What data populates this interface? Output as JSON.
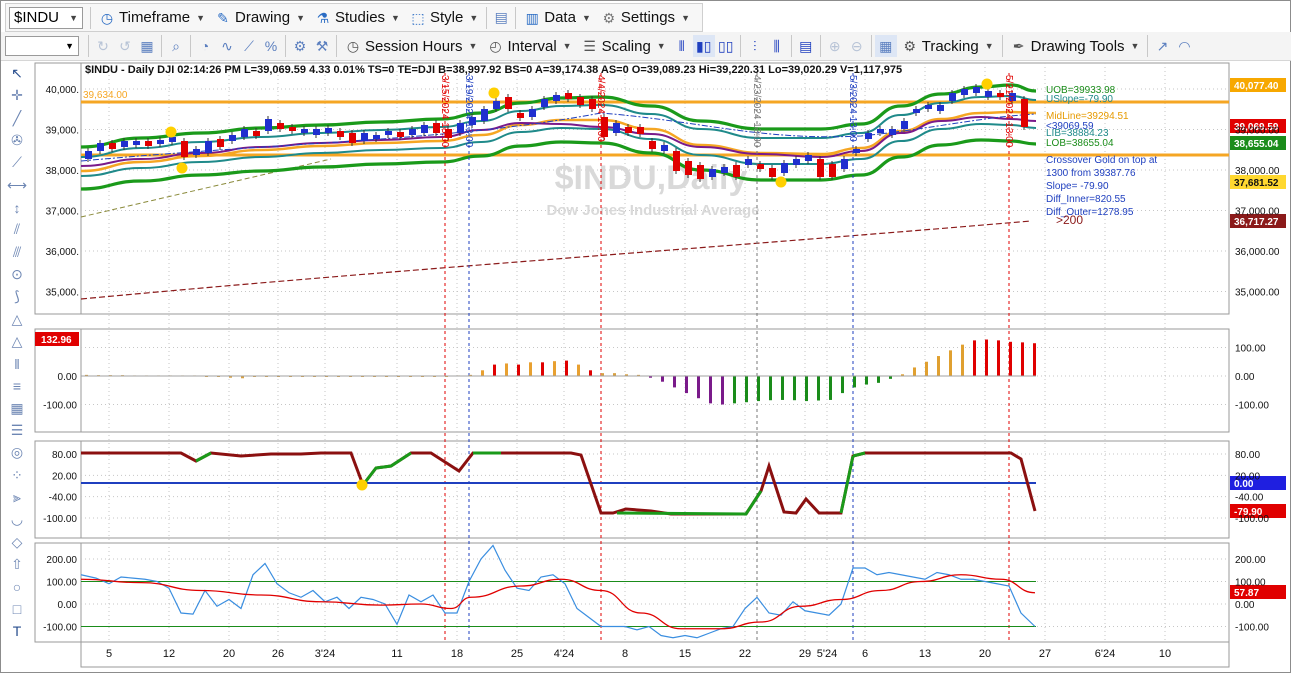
{
  "toolbar1": {
    "symbol": "$INDU",
    "timeframe": "Timeframe",
    "drawing": "Drawing",
    "studies": "Studies",
    "style": "Style",
    "data": "Data",
    "settings": "Settings"
  },
  "toolbar2": {
    "session_hours": "Session Hours",
    "interval": "Interval",
    "scaling": "Scaling",
    "tracking": "Tracking",
    "drawing_tools": "Drawing Tools"
  },
  "header": {
    "line": "$INDU - Daily  DJI  02:14:26 PM  L=39,069.59  4.33  0.01%  TS=0  TE=DJI  B=38,997.92  BS=0  A=39,174.38  AS=0  O=39,089.23  Hi=39,220.31  Lo=39,020.29  V=1,117,975"
  },
  "watermark": {
    "symbol": "$INDU,Daily",
    "name": "Dow Jones Industrial Average"
  },
  "price_panel": {
    "left_level": "39,634.00",
    "axis": [
      "40,000.",
      "39,000.",
      "38,000.",
      "37,000.",
      "36,000.",
      "35,000."
    ],
    "right_axis": [
      "39,000.00",
      "38,000.00",
      "37,000.00",
      "36,000.00",
      "35,000.00"
    ],
    "legend": {
      "uob": "UOB=39933.98",
      "slope": "USlope=-79.90",
      "midline": "MidLine=39294.51",
      "lower": "<39069.59",
      "lib": "LIB=38884.23",
      "lob": "LOB=38655.04",
      "cross1": "Crossover Gold on top at",
      "cross2": "1300 from 39387.76",
      "cross3": "Slope= -79.90",
      "cross4": "Diff_Inner=820.55",
      "cross5": "Diff_Outer=1278.95",
      "gt200": ">200"
    },
    "badges": [
      {
        "text": "40,077.40",
        "bg": "#f7a800"
      },
      {
        "text": "39,069.59",
        "bg": "#e00000"
      },
      {
        "text": "38,655.04",
        "bg": "#1a8c1a"
      },
      {
        "text": "37,681.52",
        "bg": "#ffd830"
      },
      {
        "text": "36,717.27",
        "bg": "#8b1a1a"
      }
    ],
    "vlines": [
      {
        "label": "3/15/2024 13:00",
        "color": "#e00000"
      },
      {
        "label": "3/19/2024 13:00",
        "color": "#1f3fbf"
      },
      {
        "label": "4/4/2024 13:00",
        "color": "#e00000"
      },
      {
        "label": "4/23/2024 13:00",
        "color": "#777777"
      },
      {
        "label": "5/3/2024 13:00",
        "color": "#1f3fbf"
      },
      {
        "label": "5/21/2024 13:00",
        "color": "#e00000"
      }
    ]
  },
  "hist_panel": {
    "badge": "132.96",
    "axis": [
      "100.00",
      "0.00",
      "-100.00"
    ],
    "left_axis": [
      "0.00",
      "-100.00"
    ]
  },
  "osc_panel": {
    "axis": [
      "80.00",
      "20.00",
      "-40.00",
      "-100.00"
    ],
    "right": [
      "80.00",
      "20.00",
      "-40.00",
      "-100.00"
    ],
    "badge1": "0.00",
    "badge2": "-79.90"
  },
  "cci_panel": {
    "axis": [
      "200.00",
      "100.00",
      "0.00",
      "-100.00"
    ],
    "right": [
      "200.00",
      "100.00",
      "0.00",
      "-100.00"
    ],
    "badge": "57.87"
  },
  "xaxis": [
    "5",
    "12",
    "20",
    "26",
    "3'24",
    "11",
    "18",
    "25",
    "4'24",
    "8",
    "15",
    "22",
    "29",
    "5'24",
    "6",
    "13",
    "20",
    "27",
    "6'24",
    "10"
  ],
  "colors": {
    "orange": "#f5a623",
    "green": "#1a9a1a",
    "teal": "#1f8a8a",
    "purple": "#7a1a8a",
    "maroon": "#8b1a1a",
    "blue": "#1f3fbf"
  }
}
